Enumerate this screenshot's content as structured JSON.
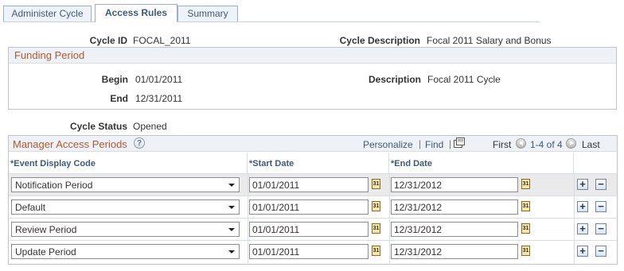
{
  "tabs": [
    {
      "label": "Administer Cycle",
      "active": false
    },
    {
      "label": "Access Rules",
      "active": true
    },
    {
      "label": "Summary",
      "active": false
    }
  ],
  "cycle": {
    "id_label": "Cycle ID",
    "id_value": "FOCAL_2011",
    "desc_label": "Cycle Description",
    "desc_value": "Focal 2011 Salary and Bonus",
    "status_label": "Cycle Status",
    "status_value": "Opened"
  },
  "funding": {
    "title": "Funding Period",
    "begin_label": "Begin",
    "begin_value": "01/01/2011",
    "end_label": "End",
    "end_value": "12/31/2011",
    "desc_label": "Description",
    "desc_value": "Focal 2011 Cycle"
  },
  "grid": {
    "title": "Manager Access Periods",
    "personalize": "Personalize",
    "find": "Find",
    "first": "First",
    "range": "1-4 of 4",
    "last": "Last",
    "columns": [
      "*Event Display Code",
      "*Start Date",
      "*End Date"
    ],
    "rows": [
      {
        "event": "Notification Period",
        "start": "01/01/2011",
        "end": "12/31/2012"
      },
      {
        "event": "Default",
        "start": "01/01/2011",
        "end": "12/31/2012"
      },
      {
        "event": "Review Period",
        "start": "01/01/2011",
        "end": "12/31/2012"
      },
      {
        "event": "Update Period",
        "start": "01/01/2011",
        "end": "12/31/2012"
      }
    ],
    "add_symbol": "+",
    "delete_symbol": "−",
    "calendar_glyph": "31"
  },
  "icons": {
    "help": "?",
    "download": "grid-download-icon"
  },
  "colors": {
    "accent_title": "#b05a30",
    "link": "#3d5a7a",
    "border": "#c4c4c4"
  }
}
